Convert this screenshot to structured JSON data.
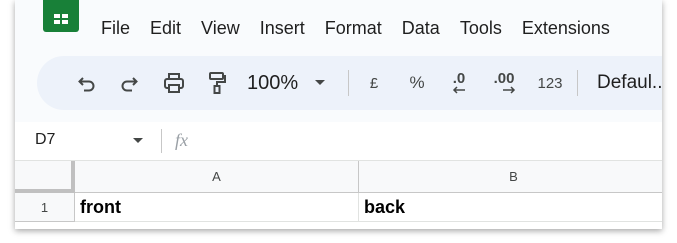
{
  "menu": {
    "items": [
      "File",
      "Edit",
      "View",
      "Insert",
      "Format",
      "Data",
      "Tools",
      "Extensions"
    ]
  },
  "toolbar": {
    "undo_icon": "undo-icon",
    "redo_icon": "redo-icon",
    "print_icon": "print-icon",
    "paint_format_icon": "paint-format-icon",
    "zoom": "100%",
    "currency": "£",
    "percent": "%",
    "decrease_decimal": ".0",
    "increase_decimal": ".00",
    "number_format": "123",
    "font": "Defaul..."
  },
  "formula_bar": {
    "name_box": "D7",
    "fx_label": "fx",
    "value": ""
  },
  "grid": {
    "columns": [
      "A",
      "B"
    ],
    "rows": [
      {
        "header": "1",
        "cells": [
          "front",
          "back"
        ]
      }
    ]
  },
  "colors": {
    "brand": "#188038",
    "toolbar_bg": "#edf2fa",
    "header_bg": "#f8f9fa"
  }
}
